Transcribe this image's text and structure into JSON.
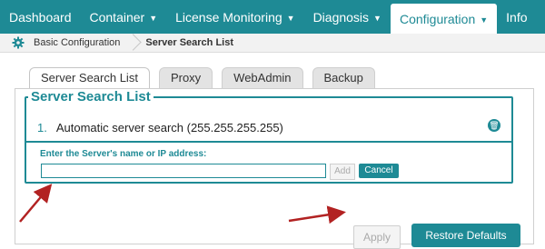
{
  "nav": {
    "items": [
      {
        "label": "Dashboard",
        "has_menu": false
      },
      {
        "label": "Container",
        "has_menu": true
      },
      {
        "label": "License Monitoring",
        "has_menu": true
      },
      {
        "label": "Diagnosis",
        "has_menu": true
      },
      {
        "label": "Configuration",
        "has_menu": true,
        "active": true
      },
      {
        "label": "Info",
        "has_menu": false
      }
    ]
  },
  "breadcrumb": {
    "home_label": "Basic Configuration",
    "current": "Server Search List"
  },
  "tabs": [
    "Server Search List",
    "Proxy",
    "WebAdmin",
    "Backup"
  ],
  "panel": {
    "legend": "Server Search List",
    "entry_number": "1.",
    "entry_text": "Automatic server search (255.255.255.255)",
    "input_label": "Enter the Server's name or IP address:",
    "input_value": "",
    "add_label": "Add",
    "cancel_label": "Cancel"
  },
  "actions": {
    "apply_label": "Apply",
    "restore_label": "Restore Defaults"
  },
  "colors": {
    "accent": "#1e8a95",
    "annotation_arrow": "#b22222"
  }
}
